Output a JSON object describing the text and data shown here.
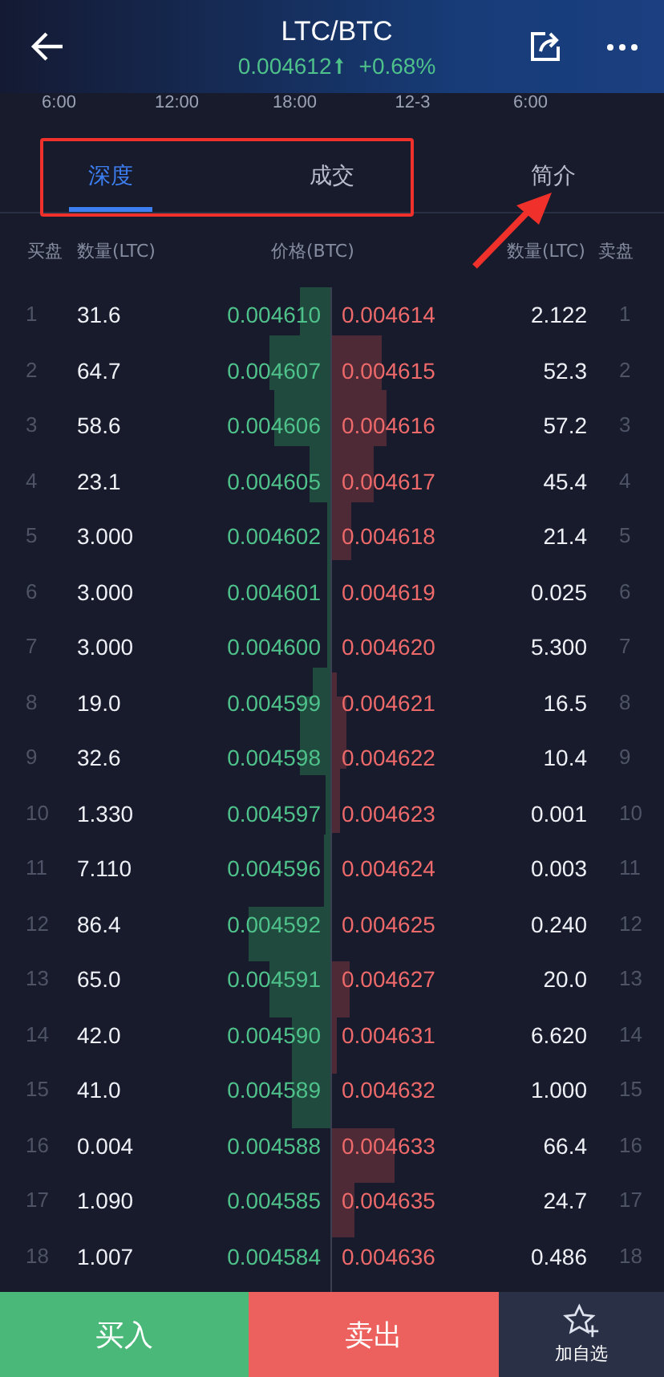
{
  "header": {
    "title": "LTC/BTC",
    "price": "0.004612",
    "change": "+0.68%"
  },
  "time_axis": [
    "6:00",
    "12:00",
    "18:00",
    "12-3",
    "6:00"
  ],
  "tabs": [
    {
      "label": "深度",
      "selected": true
    },
    {
      "label": "成交",
      "selected": false
    },
    {
      "label": "简介",
      "selected": false
    }
  ],
  "columns": {
    "bid_side": "买盘",
    "bid_amount": "数量(LTC)",
    "price": "价格(BTC)",
    "ask_amount": "数量(LTC)",
    "ask_side": "卖盘"
  },
  "rows": [
    {
      "index": "1",
      "bid_amount": "31.6",
      "bid_price": "0.004610",
      "ask_price": "0.004614",
      "ask_amount": "2.122",
      "ask_index": "1"
    },
    {
      "index": "2",
      "bid_amount": "64.7",
      "bid_price": "0.004607",
      "ask_price": "0.004615",
      "ask_amount": "52.3",
      "ask_index": "2"
    },
    {
      "index": "3",
      "bid_amount": "58.6",
      "bid_price": "0.004606",
      "ask_price": "0.004616",
      "ask_amount": "57.2",
      "ask_index": "3"
    },
    {
      "index": "4",
      "bid_amount": "23.1",
      "bid_price": "0.004605",
      "ask_price": "0.004617",
      "ask_amount": "45.4",
      "ask_index": "4"
    },
    {
      "index": "5",
      "bid_amount": "3.000",
      "bid_price": "0.004602",
      "ask_price": "0.004618",
      "ask_amount": "21.4",
      "ask_index": "5"
    },
    {
      "index": "6",
      "bid_amount": "3.000",
      "bid_price": "0.004601",
      "ask_price": "0.004619",
      "ask_amount": "0.025",
      "ask_index": "6"
    },
    {
      "index": "7",
      "bid_amount": "3.000",
      "bid_price": "0.004600",
      "ask_price": "0.004620",
      "ask_amount": "5.300",
      "ask_index": "7"
    },
    {
      "index": "8",
      "bid_amount": "19.0",
      "bid_price": "0.004599",
      "ask_price": "0.004621",
      "ask_amount": "16.5",
      "ask_index": "8"
    },
    {
      "index": "9",
      "bid_amount": "32.6",
      "bid_price": "0.004598",
      "ask_price": "0.004622",
      "ask_amount": "10.4",
      "ask_index": "9"
    },
    {
      "index": "10",
      "bid_amount": "1.330",
      "bid_price": "0.004597",
      "ask_price": "0.004623",
      "ask_amount": "0.001",
      "ask_index": "10"
    },
    {
      "index": "11",
      "bid_amount": "7.110",
      "bid_price": "0.004596",
      "ask_price": "0.004624",
      "ask_amount": "0.003",
      "ask_index": "11"
    },
    {
      "index": "12",
      "bid_amount": "86.4",
      "bid_price": "0.004592",
      "ask_price": "0.004625",
      "ask_amount": "0.240",
      "ask_index": "12"
    },
    {
      "index": "13",
      "bid_amount": "65.0",
      "bid_price": "0.004591",
      "ask_price": "0.004627",
      "ask_amount": "20.0",
      "ask_index": "13"
    },
    {
      "index": "14",
      "bid_amount": "42.0",
      "bid_price": "0.004590",
      "ask_price": "0.004631",
      "ask_amount": "6.620",
      "ask_index": "14"
    },
    {
      "index": "15",
      "bid_amount": "41.0",
      "bid_price": "0.004589",
      "ask_price": "0.004632",
      "ask_amount": "1.000",
      "ask_index": "15"
    },
    {
      "index": "16",
      "bid_amount": "0.004",
      "bid_price": "0.004588",
      "ask_price": "0.004633",
      "ask_amount": "66.4",
      "ask_index": "16"
    },
    {
      "index": "17",
      "bid_amount": "1.090",
      "bid_price": "0.004585",
      "ask_price": "0.004635",
      "ask_amount": "24.7",
      "ask_index": "17"
    },
    {
      "index": "18",
      "bid_amount": "1.007",
      "bid_price": "0.004584",
      "ask_price": "0.004636",
      "ask_amount": "0.486",
      "ask_index": "18"
    }
  ],
  "bottom_bar": {
    "buy": "买入",
    "sell": "卖出",
    "watchlist": "加自选"
  }
}
